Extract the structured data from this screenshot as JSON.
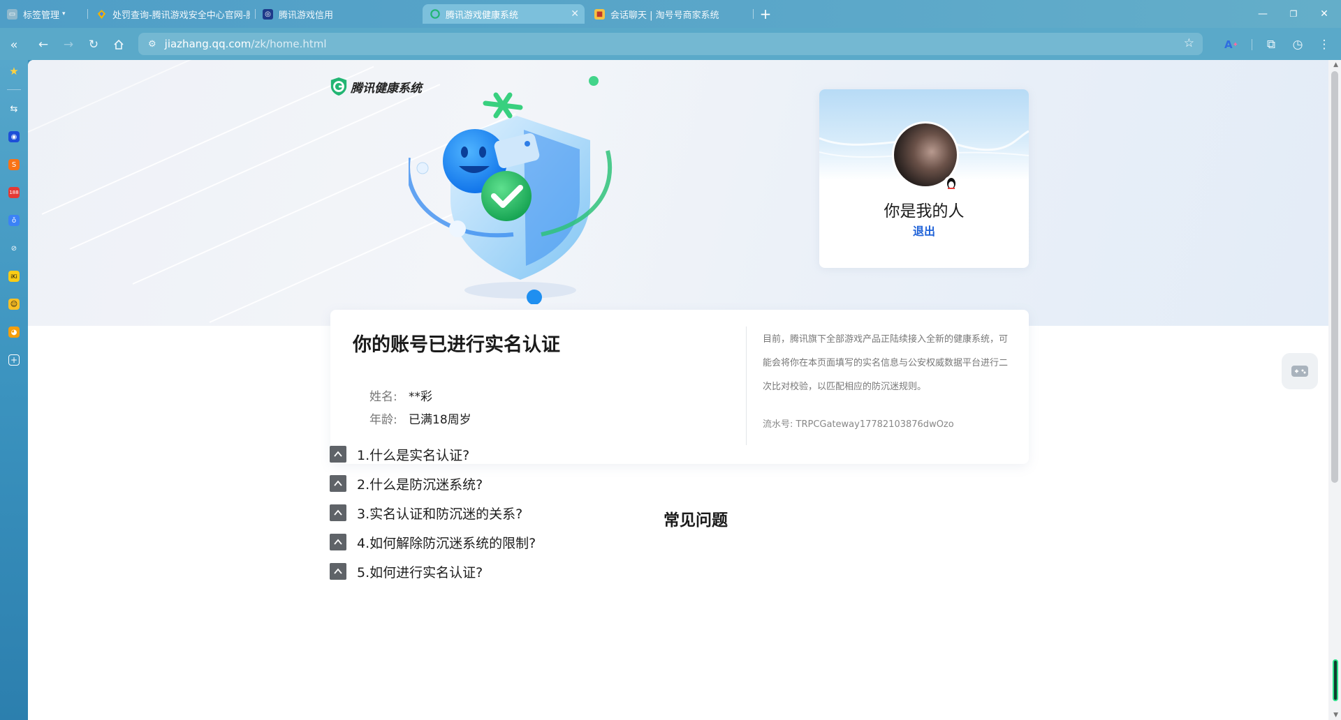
{
  "browser": {
    "tabs": [
      {
        "label": "标签管理",
        "favicon": "tab-manager-icon"
      },
      {
        "label": "处罚查询-腾讯游戏安全中心官网-腾",
        "favicon": "tencent-security-icon"
      },
      {
        "label": "腾讯游戏信用",
        "favicon": "game-credit-icon"
      },
      {
        "label": "腾讯游戏健康系统",
        "favicon": "health-system-icon",
        "active": true
      },
      {
        "label": "会话聊天 | 淘号号商家系统",
        "favicon": "chat-icon"
      }
    ],
    "url_host": "jiazhang.qq.com",
    "url_path": "/zk/home.html",
    "ai_label": "A"
  },
  "page": {
    "logo_text": "腾讯健康系统",
    "profile": {
      "nickname": "你是我的人",
      "logout_label": "退出"
    },
    "certification": {
      "title": "你的账号已进行实名认证",
      "name_label": "姓名:",
      "name_value": "**彩",
      "age_label": "年龄:",
      "age_value": "已满18周岁",
      "note": "目前，腾讯旗下全部游戏产品正陆续接入全新的健康系统，可能会将你在本页面填写的实名信息与公安权威数据平台进行二次比对校验，以匹配相应的防沉迷规则。",
      "serial": "流水号: TRPCGateway17782103876dwOzo"
    },
    "faq": {
      "heading": "常见问题",
      "items": [
        "1.什么是实名认证?",
        "2.什么是防沉迷系统?",
        "3.实名认证和防沉迷的关系?",
        "4.如何解除防沉迷系统的限制?",
        "5.如何进行实名认证?"
      ]
    }
  },
  "colors": {
    "brand_green": "#22b573",
    "link_blue": "#1f62d8",
    "browser_chrome": "#5aa9c9"
  }
}
